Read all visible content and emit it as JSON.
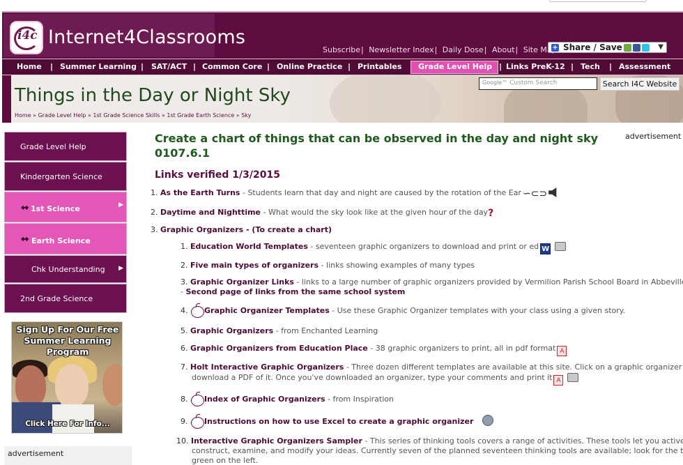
{
  "header": {
    "logo_badge": "i4c",
    "logo_text": "Internet4Classrooms",
    "top_links": [
      "Subscribe",
      "Newsletter Index",
      "Daily Dose",
      "About",
      "Site Map"
    ],
    "share_label": "Share / Save"
  },
  "nav": {
    "items": [
      "Home",
      "Summer Learning",
      "SAT/ACT",
      "Common Core",
      "Online Practice",
      "Printables",
      "Grade Level Help",
      "Links PreK-12",
      "Tech",
      "Assessment"
    ],
    "active_index": 6
  },
  "banner": {
    "title": "Things in the Day or Night Sky",
    "breadcrumb": "Home » Grade Level Help » 1st Grade Science Skills » 1st Grade Earth Science » Sky",
    "search_placeholder": "Custom Search",
    "search_google": "Google™",
    "search_button": "Search I4C Website"
  },
  "sidebar": {
    "items": [
      "Grade Level Help",
      "Kindergarten Science",
      "1st Science",
      "Earth Science",
      "Chk Understanding",
      "2nd Grade Science"
    ],
    "promo": {
      "headline": "Sign Up For Our Free Summer Learning Program",
      "cta": "Click Here For Info..."
    },
    "advertisement": "advertisement"
  },
  "main": {
    "advertisement": "advertisement",
    "heading": "Create a chart of things that can be observed in the day and night sky 0107.6.1",
    "verified": "Links verified 1/3/2015",
    "items": [
      {
        "num": "1.",
        "title": "As the Earth Turns",
        "desc": " - Students learn that day and night are caused by the rotation of the Ear"
      },
      {
        "num": "2.",
        "title": "Daytime and Nighttime",
        "desc": " - What would the sky look like at the given hour of the day"
      },
      {
        "num": "3.",
        "title": "Graphic Organizers - (To create a chart)",
        "desc": ""
      }
    ],
    "subitems": [
      {
        "num": "1.",
        "title": "Education World Templates",
        "desc": " - seventeen graphic organizers to download and print or ed"
      },
      {
        "num": "2.",
        "title": "Five main types of organizers",
        "desc": " - links showing examples of many types"
      },
      {
        "num": "3.",
        "title": "Graphic Organizer Links",
        "desc": " - links to a large number of graphic organizers provided by Vermilion Parish School Board in Abbeville, LA",
        "extra": "Second page of links from the same school system"
      },
      {
        "num": "4.",
        "title": "Graphic Organizer Templates",
        "desc": " - Use these Graphic Organizer templates with your class using a given story."
      },
      {
        "num": "5.",
        "title": "Graphic Organizers",
        "desc": " - from Enchanted Learning"
      },
      {
        "num": "6.",
        "title": "Graphic Organizers from Education Place",
        "desc": " - 38 graphic organizers to print, all in pdf format"
      },
      {
        "num": "7.",
        "title": "Holt Interactive Graphic Organizers",
        "desc": " - Three dozen different templates are available at this site. Click on a graphic organizer to",
        "desc2": "download a PDF of it. Once you've downloaded an organizer, type your comments and print it"
      },
      {
        "num": "8.",
        "title": "Index of Graphic Organizers",
        "desc": " - from Inspiration"
      },
      {
        "num": "9.",
        "title": "Instructions on how to use Excel to create a graphic organizer",
        "desc": ""
      },
      {
        "num": "10.",
        "title": "Interactive Graphic Organizers Sampler",
        "desc": " - This series of thinking tools covers a range of activities. These tools let you actively",
        "desc2": "construct, examine, and modify your ideas. Currently seven of the planned seventeen thinking tools are available; look for the titles in",
        "desc3": "green on the left."
      }
    ]
  },
  "colors": {
    "brand": "#5e0c40",
    "accent_pink": "#e457b7",
    "heading_green": "#1f5a1f"
  }
}
